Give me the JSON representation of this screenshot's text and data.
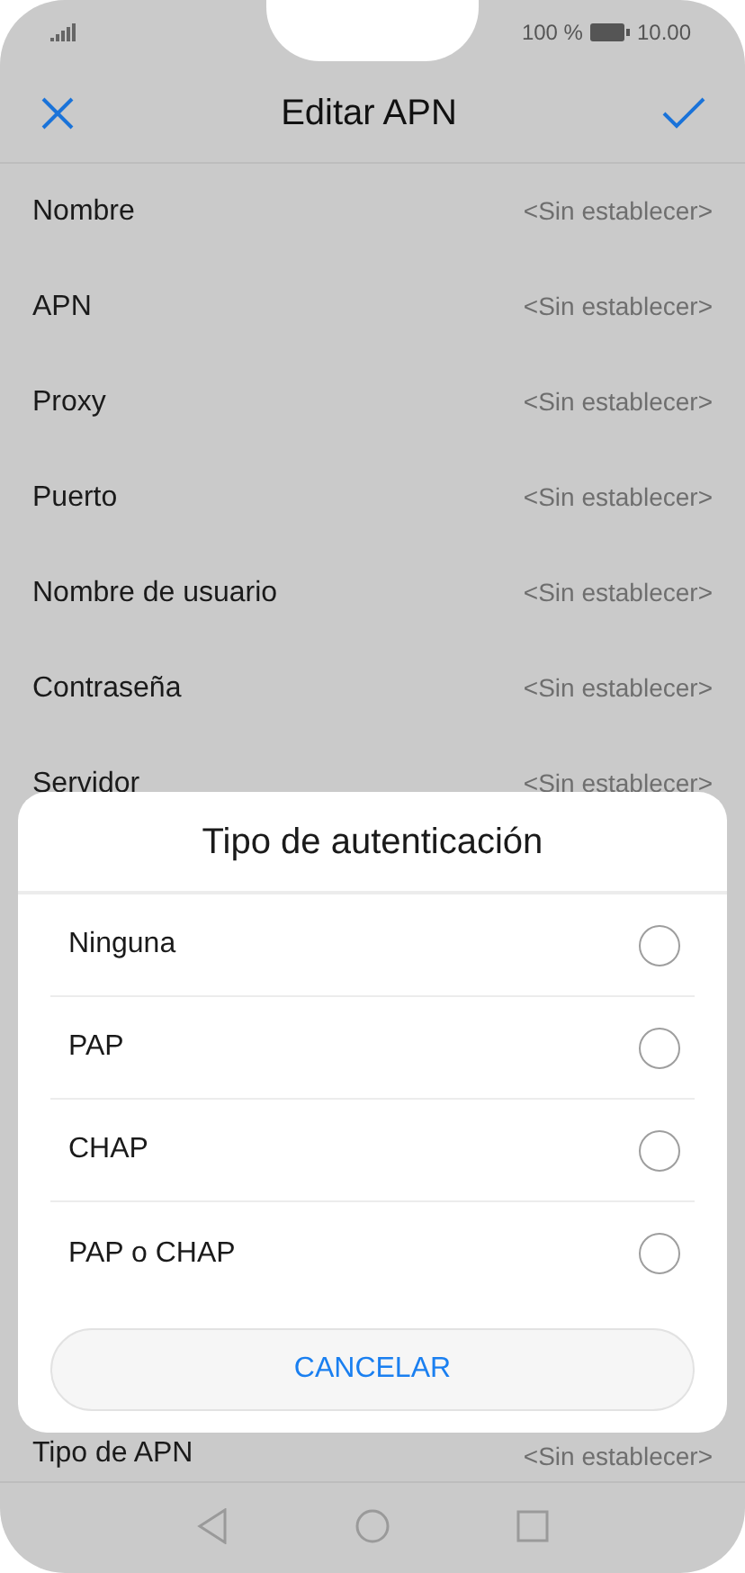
{
  "status_bar": {
    "battery": "100 %",
    "time": "10.00"
  },
  "header": {
    "title": "Editar APN"
  },
  "settings": [
    {
      "label": "Nombre",
      "value": "<Sin establecer>"
    },
    {
      "label": "APN",
      "value": "<Sin establecer>"
    },
    {
      "label": "Proxy",
      "value": "<Sin establecer>"
    },
    {
      "label": "Puerto",
      "value": "<Sin establecer>"
    },
    {
      "label": "Nombre de usuario",
      "value": "<Sin establecer>"
    },
    {
      "label": "Contraseña",
      "value": "<Sin establecer>"
    },
    {
      "label": "Servidor",
      "value": "<Sin establecer>"
    }
  ],
  "last_setting": {
    "label": "Tipo de APN",
    "value": "<Sin establecer>"
  },
  "dialog": {
    "title": "Tipo de autenticación",
    "options": [
      {
        "label": "Ninguna",
        "selected": false
      },
      {
        "label": "PAP",
        "selected": false
      },
      {
        "label": "CHAP",
        "selected": false
      },
      {
        "label": "PAP o CHAP",
        "selected": false
      }
    ],
    "cancel": "CANCELAR"
  }
}
